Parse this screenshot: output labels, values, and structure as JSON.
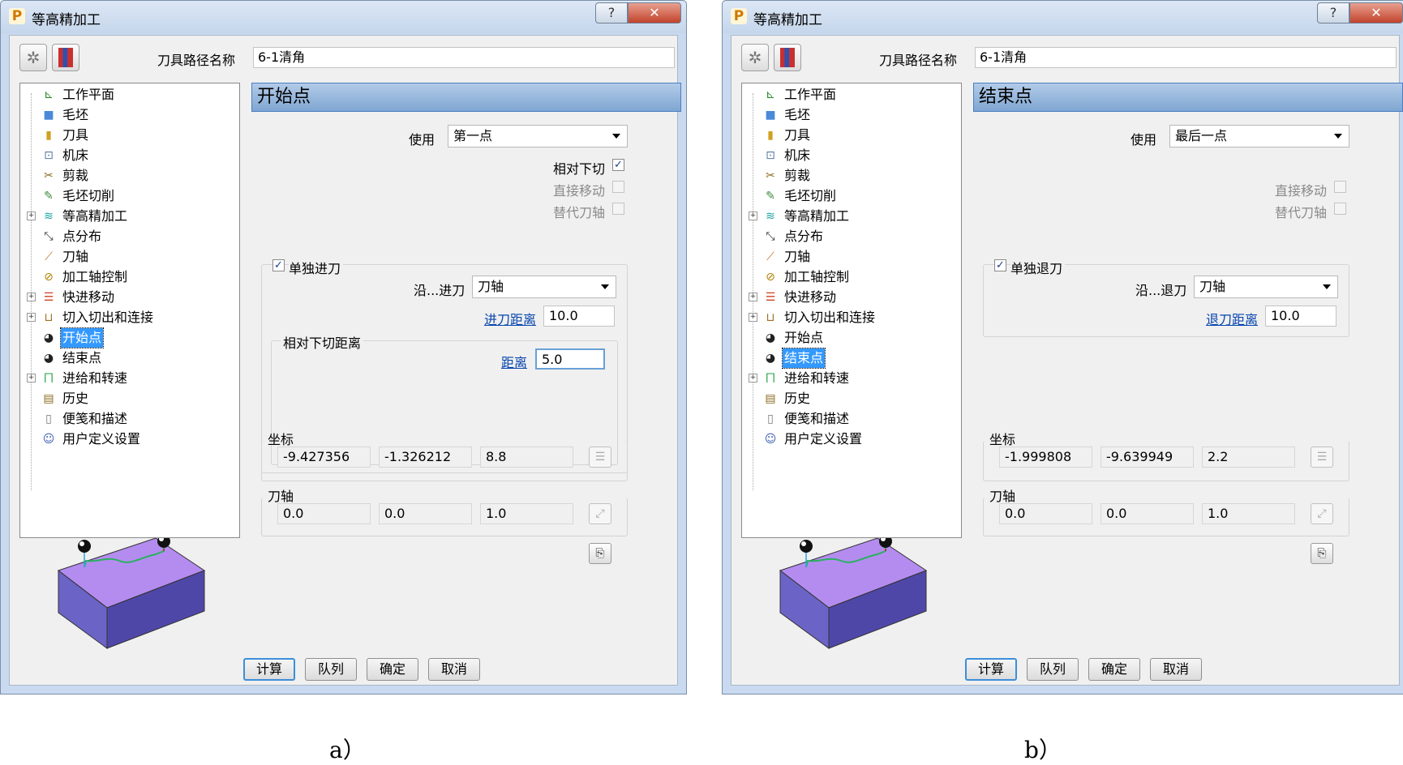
{
  "a": {
    "title": "等高精加工",
    "name_label": "刀具路径名称",
    "name_value": "6-1清角",
    "panel_title": "开始点",
    "use_label": "使用",
    "use_value": "第一点",
    "opt1": "相对下切",
    "opt2": "直接移动",
    "opt3": "替代刀轴",
    "separate_label": "单独进刀",
    "along_label": "沿...进刀",
    "along_value": "刀轴",
    "distance_label": "进刀距离",
    "distance_value": "10.0",
    "rel_group_label": "相对下切距离",
    "rel_distance_label": "距离",
    "rel_distance_value": "5.0",
    "coords_label": "坐标",
    "coords": [
      "-9.427356",
      "-1.326212",
      "8.8"
    ],
    "axis_label": "刀轴",
    "axis": [
      "0.0",
      "0.0",
      "1.0"
    ]
  },
  "b": {
    "title": "等高精加工",
    "name_label": "刀具路径名称",
    "name_value": "6-1清角",
    "panel_title": "结束点",
    "use_label": "使用",
    "use_value": "最后一点",
    "opt2": "直接移动",
    "opt3": "替代刀轴",
    "separate_label": "单独退刀",
    "along_label": "沿...退刀",
    "along_value": "刀轴",
    "distance_label": "退刀距离",
    "distance_value": "10.0",
    "coords_label": "坐标",
    "coords": [
      "-1.999808",
      "-9.639949",
      "2.2"
    ],
    "axis_label": "刀轴",
    "axis": [
      "0.0",
      "0.0",
      "1.0"
    ]
  },
  "tree": [
    "工作平面",
    "毛坯",
    "刀具",
    "机床",
    "剪裁",
    "毛坯切削",
    "等高精加工",
    "点分布",
    "刀轴",
    "加工轴控制",
    "快进移动",
    "切入切出和连接",
    "开始点",
    "结束点",
    "进给和转速",
    "历史",
    "便笺和描述",
    "用户定义设置"
  ],
  "buttons": [
    "计算",
    "队列",
    "确定",
    "取消"
  ],
  "captions": [
    "a）",
    "b）"
  ],
  "colors": {
    "selection": "#3399ff",
    "header": "#8fb3dc",
    "block_top": "#b48cf0",
    "block_side": "#6b64c6"
  }
}
